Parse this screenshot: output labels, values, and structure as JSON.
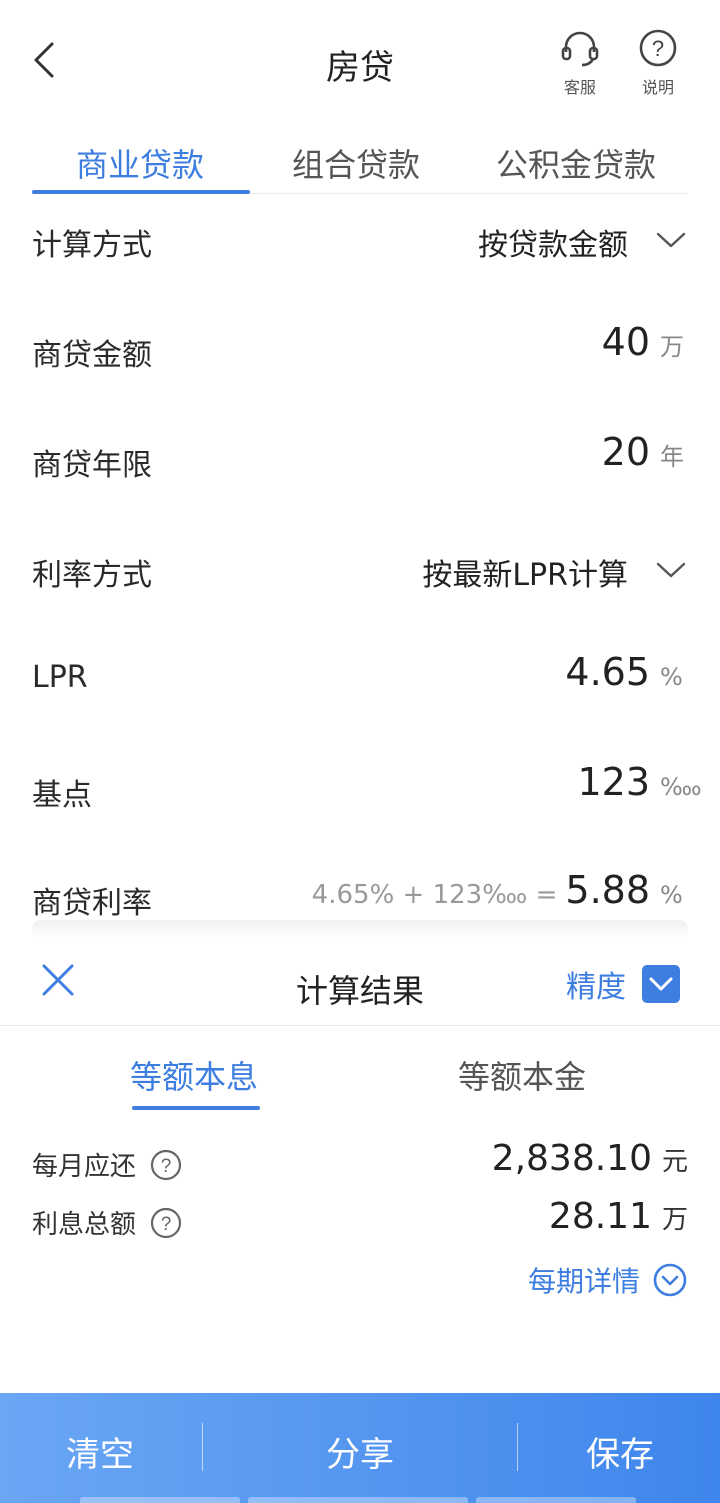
{
  "header": {
    "title": "房贷",
    "service_label": "客服",
    "help_label": "说明",
    "help_glyph": "?"
  },
  "tabs": [
    {
      "label": "商业贷款",
      "active": true
    },
    {
      "label": "组合贷款",
      "active": false
    },
    {
      "label": "公积金贷款",
      "active": false
    }
  ],
  "form": {
    "calc_method": {
      "label": "计算方式",
      "value": "按贷款金额"
    },
    "loan_amount": {
      "label": "商贷金额",
      "value": "40",
      "unit": "万"
    },
    "loan_years": {
      "label": "商贷年限",
      "value": "20",
      "unit": "年"
    },
    "rate_method": {
      "label": "利率方式",
      "value": "按最新LPR计算"
    },
    "lpr": {
      "label": "LPR",
      "value": "4.65",
      "unit": "%"
    },
    "basis_points": {
      "label": "基点",
      "value": "123",
      "unit": "‱"
    },
    "loan_rate": {
      "label": "商贷利率",
      "formula": "4.65% + 123‱ =",
      "value": "5.88",
      "unit": "%"
    }
  },
  "result": {
    "title": "计算结果",
    "precision_label": "精度",
    "precision_checked": true,
    "tabs": [
      {
        "label": "等额本息",
        "active": true
      },
      {
        "label": "等额本金",
        "active": false
      }
    ],
    "monthly": {
      "label": "每月应还",
      "value": "2,838.10",
      "unit": "元"
    },
    "interest": {
      "label": "利息总额",
      "value": "28.11",
      "unit": "万"
    },
    "details_label": "每期详情"
  },
  "bottom": {
    "clear_label": "清空",
    "share_label": "分享",
    "save_label": "保存"
  },
  "colors": {
    "accent": "#3d7ee0",
    "bar_start": "#6aa6f4",
    "bar_end": "#3f86ec"
  }
}
